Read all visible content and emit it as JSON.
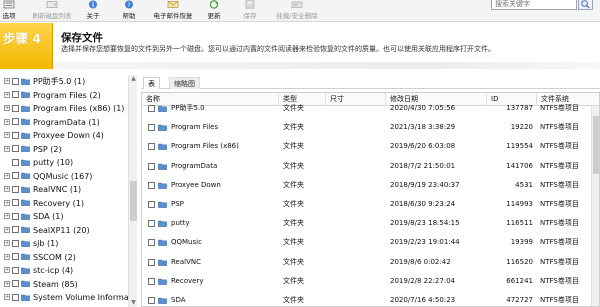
{
  "toolbar": {
    "buttons": [
      {
        "label": "选项",
        "icon": "options-icon",
        "disabled": false
      },
      {
        "label": "刷新磁盘列表",
        "icon": "refresh-disks-icon",
        "disabled": true
      },
      {
        "label": "关于",
        "icon": "about-icon",
        "disabled": false
      },
      {
        "label": "帮助",
        "icon": "help-icon",
        "disabled": false
      },
      {
        "label": "电子邮件恢复",
        "icon": "email-recovery-icon",
        "disabled": false
      },
      {
        "label": "更新",
        "icon": "update-icon",
        "disabled": false
      },
      {
        "label": "保存",
        "icon": "save-icon",
        "disabled": true
      },
      {
        "label": "挂载/安全删除",
        "icon": "mount-icon",
        "disabled": true
      }
    ],
    "search_placeholder": "搜索关键字"
  },
  "step": {
    "number_label": "步骤 4",
    "title": "保存文件",
    "description": "选择并保存您想要恢复的文件到另外一个磁盘。您可以通过内置的文件阅读器来检验恢复的文件的质量。也可以使用关联应用程序打开文件。"
  },
  "tree": {
    "items": [
      {
        "label": "PP助手5.0 (1)",
        "expandable": true
      },
      {
        "label": "Program Files (2)",
        "expandable": true
      },
      {
        "label": "Program Files (x86) (1)",
        "expandable": true
      },
      {
        "label": "ProgramData (1)",
        "expandable": true
      },
      {
        "label": "Proxyee Down (4)",
        "expandable": true
      },
      {
        "label": "PSP (2)",
        "expandable": true
      },
      {
        "label": "putty (10)",
        "expandable": false
      },
      {
        "label": "QQMusic (167)",
        "expandable": true
      },
      {
        "label": "RealVNC (1)",
        "expandable": true
      },
      {
        "label": "Recovery (1)",
        "expandable": true
      },
      {
        "label": "SDA (1)",
        "expandable": true
      },
      {
        "label": "SealXP11 (20)",
        "expandable": true
      },
      {
        "label": "sjb (1)",
        "expandable": true
      },
      {
        "label": "SSCOM (2)",
        "expandable": true
      },
      {
        "label": "stc-icp (4)",
        "expandable": true
      },
      {
        "label": "Steam (85)",
        "expandable": true
      },
      {
        "label": "System Volume Informat",
        "expandable": true
      }
    ]
  },
  "tabs": [
    {
      "label": "表",
      "active": true
    },
    {
      "label": "缩略图",
      "active": false
    }
  ],
  "grid": {
    "columns": [
      "名称",
      "类型",
      "尺寸",
      "修改日期",
      "ID",
      "文件系统"
    ],
    "rows": [
      {
        "name": "PP助手5.0",
        "type": "文件夹",
        "size": "",
        "date": "2020/4/30 7:05:56",
        "id": "137787",
        "fs": "NTFS卷项目"
      },
      {
        "name": "Program Files",
        "type": "文件夹",
        "size": "",
        "date": "2021/3/18 3:38:29",
        "id": "19220",
        "fs": "NTFS卷项目"
      },
      {
        "name": "Program Files (x86)",
        "type": "文件夹",
        "size": "",
        "date": "2019/6/20 6:03:08",
        "id": "119554",
        "fs": "NTFS卷项目"
      },
      {
        "name": "ProgramData",
        "type": "文件夹",
        "size": "",
        "date": "2018/7/2 21:50:01",
        "id": "141706",
        "fs": "NTFS卷项目"
      },
      {
        "name": "Proxyee Down",
        "type": "文件夹",
        "size": "",
        "date": "2018/9/19 23:40:37",
        "id": "4531",
        "fs": "NTFS卷项目"
      },
      {
        "name": "PSP",
        "type": "文件夹",
        "size": "",
        "date": "2018/6/30 9:23:24",
        "id": "114993",
        "fs": "NTFS卷项目"
      },
      {
        "name": "putty",
        "type": "文件夹",
        "size": "",
        "date": "2019/8/23 18:54:15",
        "id": "116511",
        "fs": "NTFS卷项目"
      },
      {
        "name": "QQMusic",
        "type": "文件夹",
        "size": "",
        "date": "2019/2/23 19:01:44",
        "id": "19399",
        "fs": "NTFS卷项目"
      },
      {
        "name": "RealVNC",
        "type": "文件夹",
        "size": "",
        "date": "2019/8/6 0:02:42",
        "id": "116520",
        "fs": "NTFS卷项目"
      },
      {
        "name": "Recovery",
        "type": "文件夹",
        "size": "",
        "date": "2019/2/8 22:27:04",
        "id": "661241",
        "fs": "NTFS卷项目"
      },
      {
        "name": "SDA",
        "type": "文件夹",
        "size": "",
        "date": "2020/7/16 4:50:23",
        "id": "472727",
        "fs": "NTFS卷项目"
      }
    ]
  },
  "colors": {
    "step_accent": "#f3b600",
    "folder": "#5b8fd0"
  }
}
